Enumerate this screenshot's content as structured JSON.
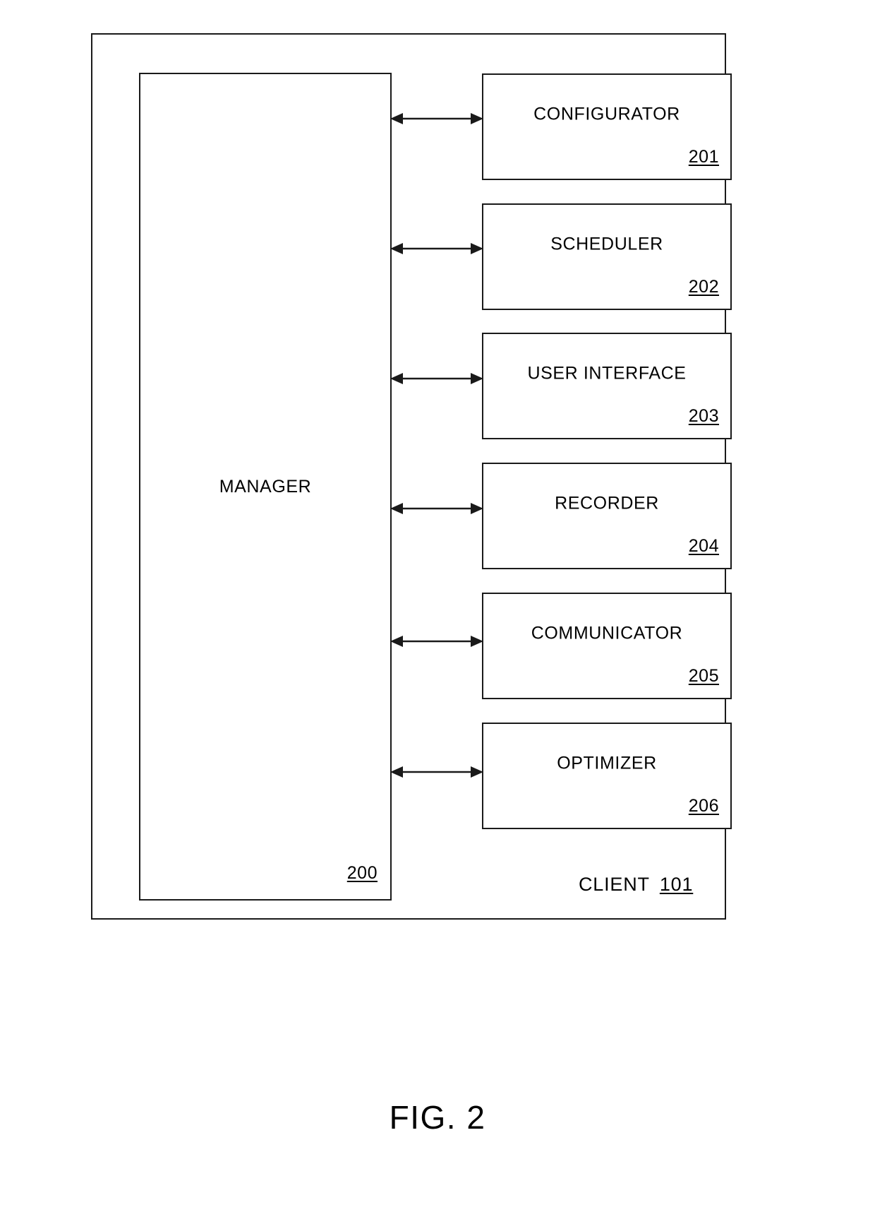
{
  "figure": {
    "caption": "FIG. 2",
    "client": {
      "label": "CLIENT",
      "ref": "101"
    },
    "manager": {
      "label": "MANAGER",
      "ref": "200"
    },
    "components": [
      {
        "label": "CONFIGURATOR",
        "ref": "201"
      },
      {
        "label": "SCHEDULER",
        "ref": "202"
      },
      {
        "label": "USER INTERFACE",
        "ref": "203"
      },
      {
        "label": "RECORDER",
        "ref": "204"
      },
      {
        "label": "COMMUNICATOR",
        "ref": "205"
      },
      {
        "label": "OPTIMIZER",
        "ref": "206"
      }
    ],
    "connectors": [
      {
        "name": "manager-configurator-connector",
        "type": "double-arrow"
      },
      {
        "name": "manager-scheduler-connector",
        "type": "double-arrow"
      },
      {
        "name": "manager-user-interface-connector",
        "type": "double-arrow"
      },
      {
        "name": "manager-recorder-connector",
        "type": "double-arrow"
      },
      {
        "name": "manager-communicator-connector",
        "type": "double-arrow"
      },
      {
        "name": "manager-optimizer-connector",
        "type": "double-arrow"
      }
    ],
    "colors": {
      "line": "#1a1a1a",
      "background": "#ffffff"
    }
  }
}
